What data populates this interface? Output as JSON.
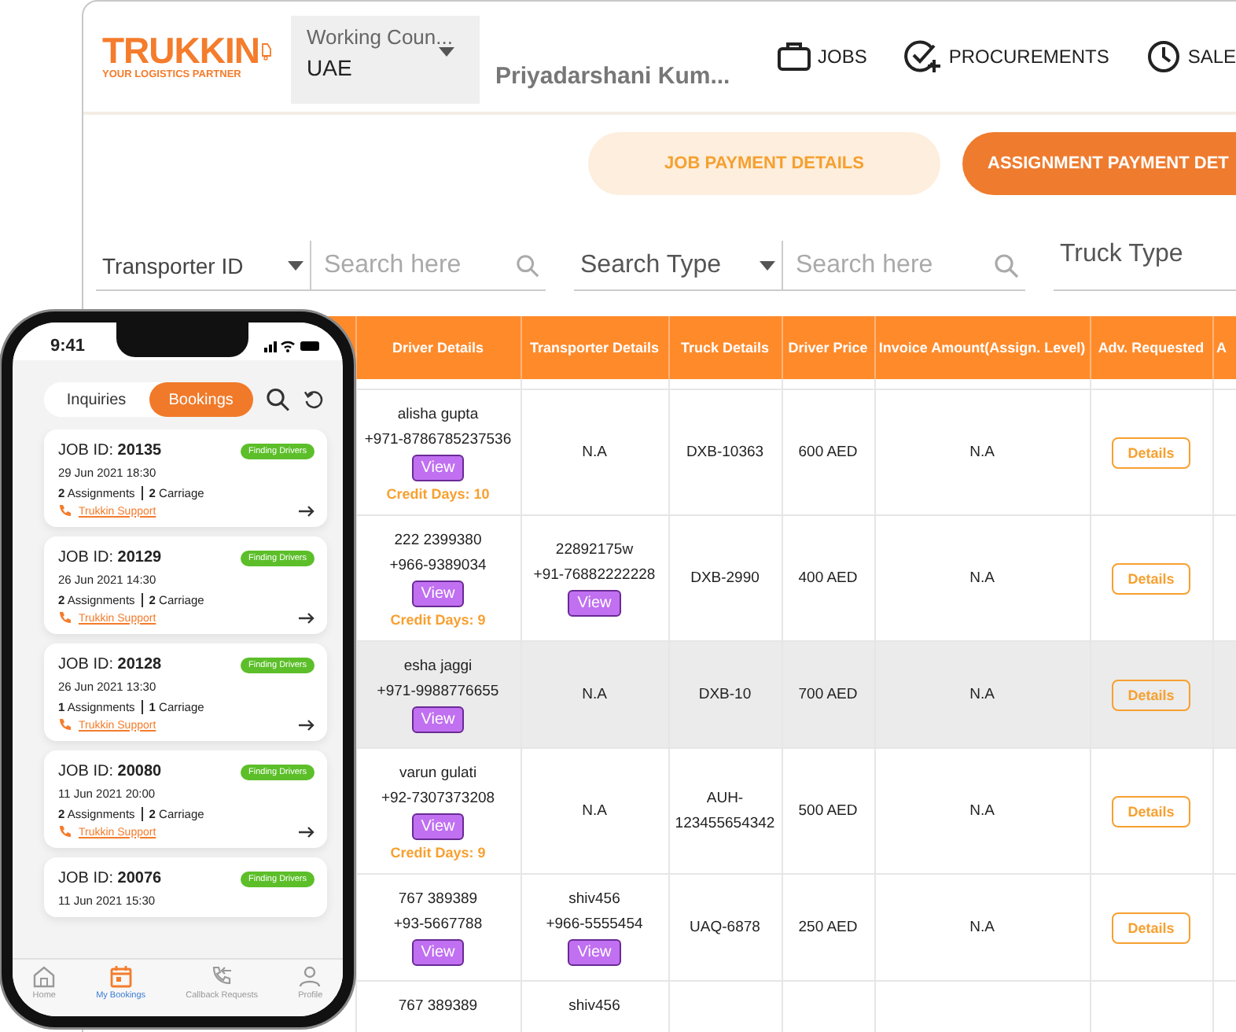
{
  "desktop": {
    "logo": {
      "word": "TRUKKIN",
      "tagline": "YOUR LOGISTICS PARTNER"
    },
    "country": {
      "label": "Working Coun...",
      "value": "UAE"
    },
    "user": "Priyadarshani Kum...",
    "nav": [
      {
        "label": "JOBS",
        "kind": "briefcase"
      },
      {
        "label": "PROCUREMENTS",
        "kind": "check"
      },
      {
        "label": "SALE",
        "kind": "clock"
      }
    ],
    "tabs": [
      {
        "label": "JOB PAYMENT DETAILS",
        "selected": false
      },
      {
        "label": "ASSIGNMENT PAYMENT DET",
        "selected": true
      }
    ],
    "filters": [
      {
        "kind": "dropdown",
        "label": "Transporter ID"
      },
      {
        "kind": "search",
        "placeholder": "Search here"
      },
      {
        "kind": "dropdown",
        "label": "Search Type"
      },
      {
        "kind": "search",
        "placeholder": "Search here"
      },
      {
        "kind": "field",
        "label": "Truck Type"
      }
    ],
    "table": {
      "columns": [
        "Driver Details",
        "Transporter Details",
        "Truck Details",
        "Driver Price",
        "Invoice Amount(Assign. Level)",
        "Adv. Requested",
        "A"
      ],
      "rows": [
        {
          "selected": false,
          "driver": {
            "lines": [
              "alisha gupta",
              "+971-8786785237536"
            ],
            "view": "View",
            "credit": "Credit Days: 10"
          },
          "transporter": {
            "lines": [
              "N.A"
            ]
          },
          "truck": "DXB-10363",
          "price": "600 AED",
          "invoice": "N.A",
          "adv": "Details"
        },
        {
          "selected": false,
          "driver": {
            "lines": [
              "222 2399380",
              "+966-9389034"
            ],
            "view": "View",
            "credit": "Credit Days: 9"
          },
          "transporter": {
            "lines": [
              "22892175w",
              "+91-76882222228"
            ],
            "view": "View"
          },
          "truck": "DXB-2990",
          "price": "400 AED",
          "invoice": "N.A",
          "adv": "Details"
        },
        {
          "selected": true,
          "driver": {
            "lines": [
              "esha jaggi",
              "+971-9988776655"
            ],
            "view": "View"
          },
          "transporter": {
            "lines": [
              "N.A"
            ]
          },
          "truck": "DXB-10",
          "price": "700 AED",
          "invoice": "N.A",
          "adv": "Details"
        },
        {
          "selected": false,
          "driver": {
            "lines": [
              "varun gulati",
              "+92-7307373208"
            ],
            "view": "View",
            "credit": "Credit Days: 9"
          },
          "transporter": {
            "lines": [
              "N.A"
            ]
          },
          "truck": "AUH-123455654342",
          "price": "500 AED",
          "invoice": "N.A",
          "adv": "Details"
        },
        {
          "selected": false,
          "driver": {
            "lines": [
              "767 389389",
              "+93-5667788"
            ],
            "view": "View"
          },
          "transporter": {
            "lines": [
              "shiv456",
              "+966-5555454"
            ],
            "view": "View"
          },
          "truck": "UAQ-6878",
          "price": "250 AED",
          "invoice": "N.A",
          "adv": "Details"
        },
        {
          "selected": false,
          "driver": {
            "lines": [
              "767 389389"
            ]
          },
          "transporter": {
            "lines": [
              "shiv456"
            ]
          }
        }
      ]
    }
  },
  "phone": {
    "time": "9:41",
    "tabs": [
      {
        "label": "Inquiries",
        "selected": false
      },
      {
        "label": "Bookings",
        "selected": true
      }
    ],
    "cards": [
      {
        "job": "JOB ID: **20135**",
        "date": "29 Jun 2021 18:30",
        "assignments": "**2** Assignments",
        "carriage": "**2** Carriage",
        "status": "Finding Drivers",
        "color": "#5cbf2a",
        "support": "Trukkin Support"
      },
      {
        "job": "JOB ID: **20129**",
        "date": "26 Jun 2021 14:30",
        "assignments": "**2** Assignments",
        "carriage": "**2** Carriage",
        "status": "Finding Drivers",
        "color": "#5cbf2a",
        "support": "Trukkin Support"
      },
      {
        "job": "JOB ID: **20128**",
        "date": "26 Jun 2021 13:30",
        "assignments": "**1** Assignments",
        "carriage": "**1** Carriage",
        "status": "Finding Drivers",
        "color": "#5cbf2a",
        "support": "Trukkin Support"
      },
      {
        "job": "JOB ID: **20080**",
        "date": "11 Jun 2021 20:00",
        "assignments": "**2** Assignments",
        "carriage": "**2** Carriage",
        "status": "Finding Drivers",
        "color": "#5cbf2a",
        "support": "Trukkin Support"
      },
      {
        "job": "JOB ID: **20076**",
        "date": "11 Jun 2021 15:30",
        "status": "Finding Drivers",
        "color": "#5cbf2a"
      }
    ],
    "bottom_nav": [
      {
        "label": "Home",
        "kind": "home",
        "selected": false
      },
      {
        "label": "My Bookings",
        "kind": "calendar",
        "selected": true
      },
      {
        "label": "Callback Requests",
        "kind": "callback",
        "selected": false
      },
      {
        "label": "Profile",
        "kind": "person",
        "selected": false
      }
    ]
  }
}
